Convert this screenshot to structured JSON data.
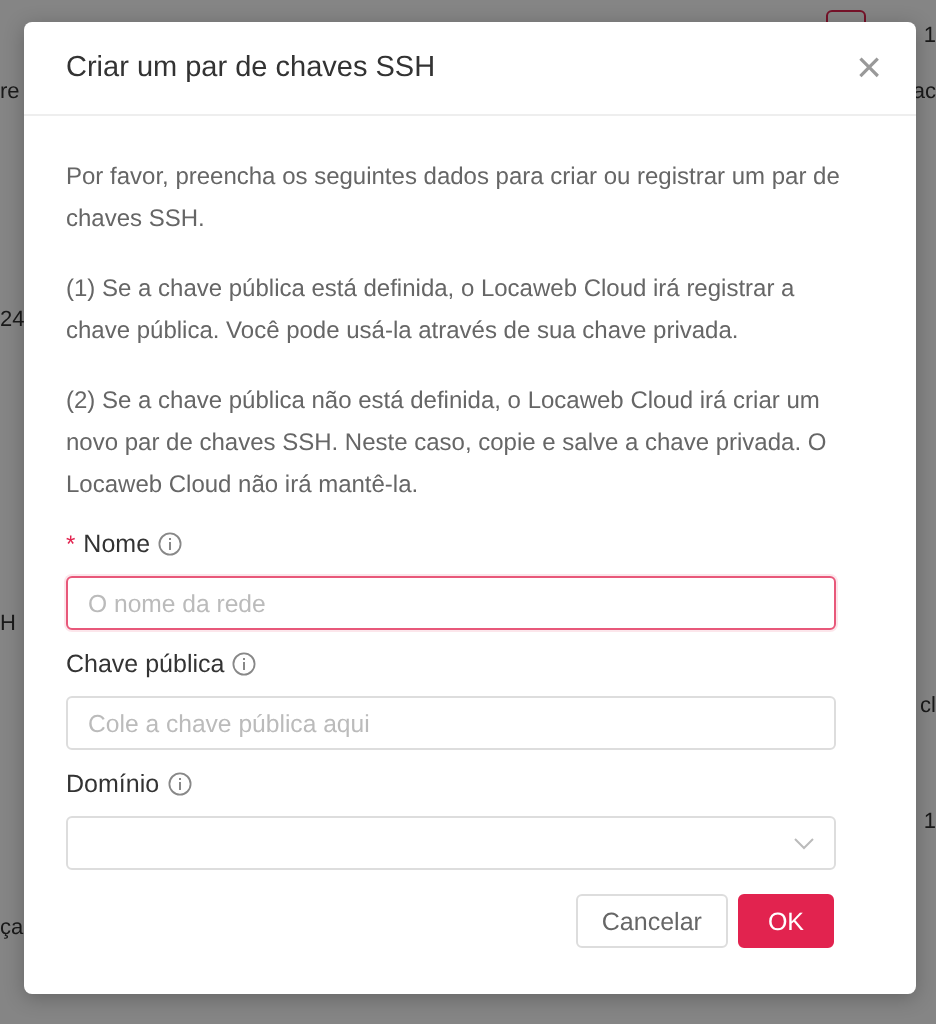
{
  "background": {
    "left_fragments": [
      "re",
      "24",
      "H",
      "ça"
    ],
    "right_fragments": [
      "1",
      "ac",
      "cl",
      "1"
    ]
  },
  "dialog": {
    "title": "Criar um par de chaves SSH",
    "close": "×",
    "paragraphs": [
      "Por favor, preencha os seguintes dados para criar ou registrar um par de chaves SSH.",
      "(1) Se a chave pública está definida, o Locaweb Cloud irá registrar a chave pública. Você pode usá-la através de sua chave privada.",
      "(2) Se a chave pública não está definida, o Locaweb Cloud irá criar um novo par de chaves SSH. Neste caso, copie e salve a chave privada. O Locaweb Cloud não irá mantê-la."
    ],
    "fields": [
      {
        "kind": "text",
        "required_mark": "*",
        "label": "Nome",
        "invalid": true,
        "placeholder": "O nome da rede"
      },
      {
        "kind": "text",
        "label": "Chave pública",
        "invalid": false,
        "placeholder": "Cole a chave pública aqui"
      },
      {
        "kind": "select",
        "label": "Domínio",
        "invalid": false
      }
    ],
    "buttons": [
      {
        "kind": "default",
        "label": "Cancelar"
      },
      {
        "kind": "primary",
        "label": "OK"
      }
    ]
  }
}
